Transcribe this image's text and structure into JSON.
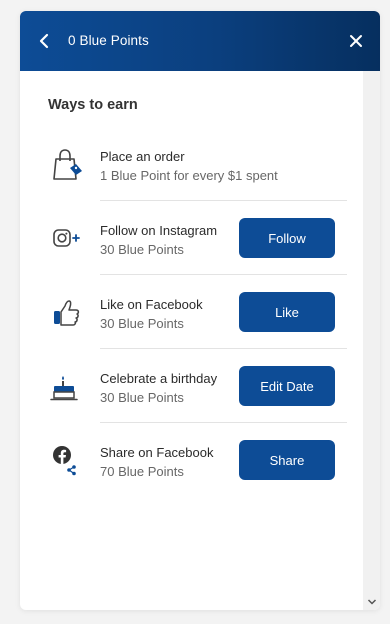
{
  "header": {
    "title": "0 Blue Points",
    "back_icon": "chevron-left-icon",
    "close_icon": "close-icon"
  },
  "section": {
    "title": "Ways to earn"
  },
  "items": [
    {
      "icon": "shopping-bag-icon",
      "title": "Place an order",
      "subtitle": "1 Blue Point for every $1 spent",
      "button": ""
    },
    {
      "icon": "instagram-icon",
      "title": "Follow on Instagram",
      "subtitle": "30 Blue Points",
      "button": "Follow"
    },
    {
      "icon": "thumbs-up-icon",
      "title": "Like on Facebook",
      "subtitle": "30 Blue Points",
      "button": "Like"
    },
    {
      "icon": "birthday-cake-icon",
      "title": "Celebrate a birthday",
      "subtitle": "30 Blue Points",
      "button": "Edit Date"
    },
    {
      "icon": "facebook-share-icon",
      "title": "Share on Facebook",
      "subtitle": "70 Blue Points",
      "button": "Share"
    }
  ],
  "colors": {
    "brand_blue": "#0d4c96",
    "header_dark": "#062f5f",
    "text_dark": "#2b2b2b",
    "text_muted": "#676767"
  }
}
